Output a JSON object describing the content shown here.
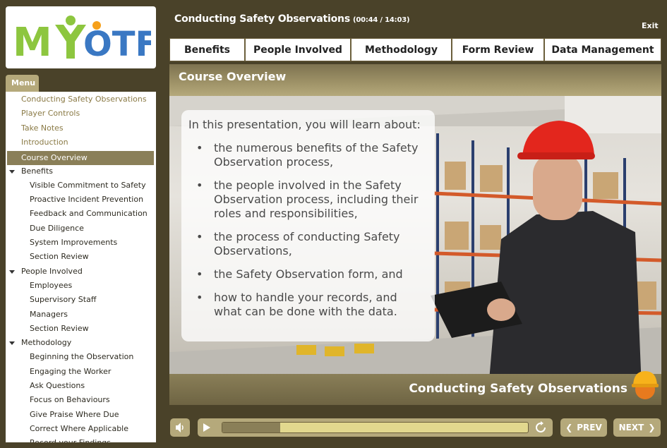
{
  "logo": {
    "text_m": "M",
    "text_otf": "OTF",
    "colors": {
      "green": "#8dc63f",
      "blue": "#3a78c3",
      "orange": "#f6a01a"
    }
  },
  "header": {
    "title": "Conducting Safety Observations",
    "time": "(00:44 / 14:03)",
    "exit": "Exit"
  },
  "tabs": [
    "Benefits",
    "People Involved",
    "Methodology",
    "Form Review",
    "Data Management"
  ],
  "course_header": "Course Overview",
  "slide": {
    "lead": "In this presentation, you will learn about:",
    "bullets": [
      "the numerous benefits of the Safety Observation process,",
      "the people involved in the Safety Observation process, including their roles and responsibilities,",
      "the process of conducting Safety Observations,",
      "the Safety Observation form, and",
      "how to handle your records, and what can be done with the data."
    ],
    "footer_title": "Conducting Safety Observations"
  },
  "menu": {
    "tab_label": "Menu",
    "items": [
      {
        "label": "Conducting Safety Observations",
        "level": 0,
        "kind": "intro"
      },
      {
        "label": "Player Controls",
        "level": 0,
        "kind": "intro"
      },
      {
        "label": "Take Notes",
        "level": 0,
        "kind": "intro"
      },
      {
        "label": "Introduction",
        "level": 0,
        "kind": "intro"
      },
      {
        "label": "Course Overview",
        "level": 0,
        "kind": "active"
      },
      {
        "label": "Benefits",
        "level": 0,
        "kind": "section"
      },
      {
        "label": "Visible Commitment to Safety",
        "level": 1,
        "kind": "sub"
      },
      {
        "label": "Proactive Incident Prevention",
        "level": 1,
        "kind": "sub"
      },
      {
        "label": "Feedback and Communication",
        "level": 1,
        "kind": "sub"
      },
      {
        "label": "Due Diligence",
        "level": 1,
        "kind": "sub"
      },
      {
        "label": "System Improvements",
        "level": 1,
        "kind": "sub"
      },
      {
        "label": "Section Review",
        "level": 1,
        "kind": "sub"
      },
      {
        "label": "People Involved",
        "level": 0,
        "kind": "section"
      },
      {
        "label": "Employees",
        "level": 1,
        "kind": "sub"
      },
      {
        "label": "Supervisory Staff",
        "level": 1,
        "kind": "sub"
      },
      {
        "label": "Managers",
        "level": 1,
        "kind": "sub"
      },
      {
        "label": "Section Review",
        "level": 1,
        "kind": "sub"
      },
      {
        "label": "Methodology",
        "level": 0,
        "kind": "section"
      },
      {
        "label": "Beginning the Observation",
        "level": 1,
        "kind": "sub"
      },
      {
        "label": "Engaging the Worker",
        "level": 1,
        "kind": "sub"
      },
      {
        "label": "Ask Questions",
        "level": 1,
        "kind": "sub"
      },
      {
        "label": "Focus on Behaviours",
        "level": 1,
        "kind": "sub"
      },
      {
        "label": "Give Praise Where Due",
        "level": 1,
        "kind": "sub"
      },
      {
        "label": "Correct Where Applicable",
        "level": 1,
        "kind": "sub"
      },
      {
        "label": "Record your Findings",
        "level": 1,
        "kind": "sub"
      }
    ]
  },
  "controls": {
    "progress_fraction": 0.19,
    "prev": "PREV",
    "next": "NEXT"
  },
  "colors": {
    "accent": "#8a7f58",
    "frame": "#4a4229",
    "button": "#b5a97b",
    "track": "#e2d88e"
  }
}
